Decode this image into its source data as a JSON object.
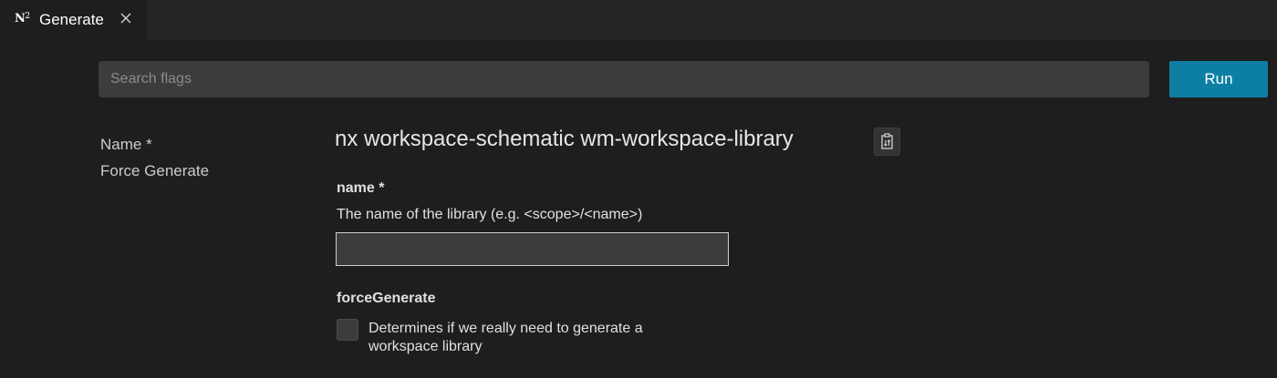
{
  "tab": {
    "logo": "N",
    "logo_superscript": "2",
    "title": "Generate",
    "close_icon": "close-icon"
  },
  "search": {
    "placeholder": "Search flags",
    "value": ""
  },
  "run_button": {
    "label": "Run",
    "color": "#0e7fa4"
  },
  "toc": {
    "items": [
      {
        "label": "Name *"
      },
      {
        "label": "Force Generate"
      }
    ]
  },
  "command": {
    "title": "nx workspace-schematic wm-workspace-library",
    "copy_icon": "copy-to-clipboard-icon"
  },
  "fields": {
    "name": {
      "label": "name *",
      "description": "The name of the library (e.g. <scope>/<name>)",
      "value": ""
    },
    "forceGenerate": {
      "label": "forceGenerate",
      "description": "Determines if we really need to generate a workspace library",
      "checked": false
    }
  }
}
